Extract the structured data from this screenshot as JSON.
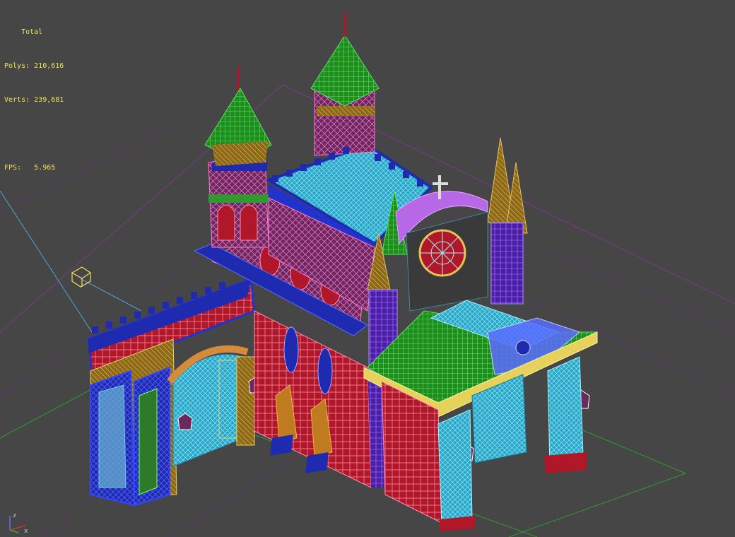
{
  "viewport": {
    "stats": {
      "heading": "Total",
      "polys_label": "Polys:",
      "polys_value": "210,616",
      "verts_label": "Verts:",
      "verts_value": "239,681",
      "fps_label": "FPS:",
      "fps_value": "5.965"
    },
    "gizmo": {
      "z": "z",
      "x": "x"
    },
    "colors": {
      "background": "#464646",
      "stats_text": "#f2e15a",
      "grid_purple": "#7a3a8a",
      "grid_green": "#2f9a2f"
    }
  }
}
